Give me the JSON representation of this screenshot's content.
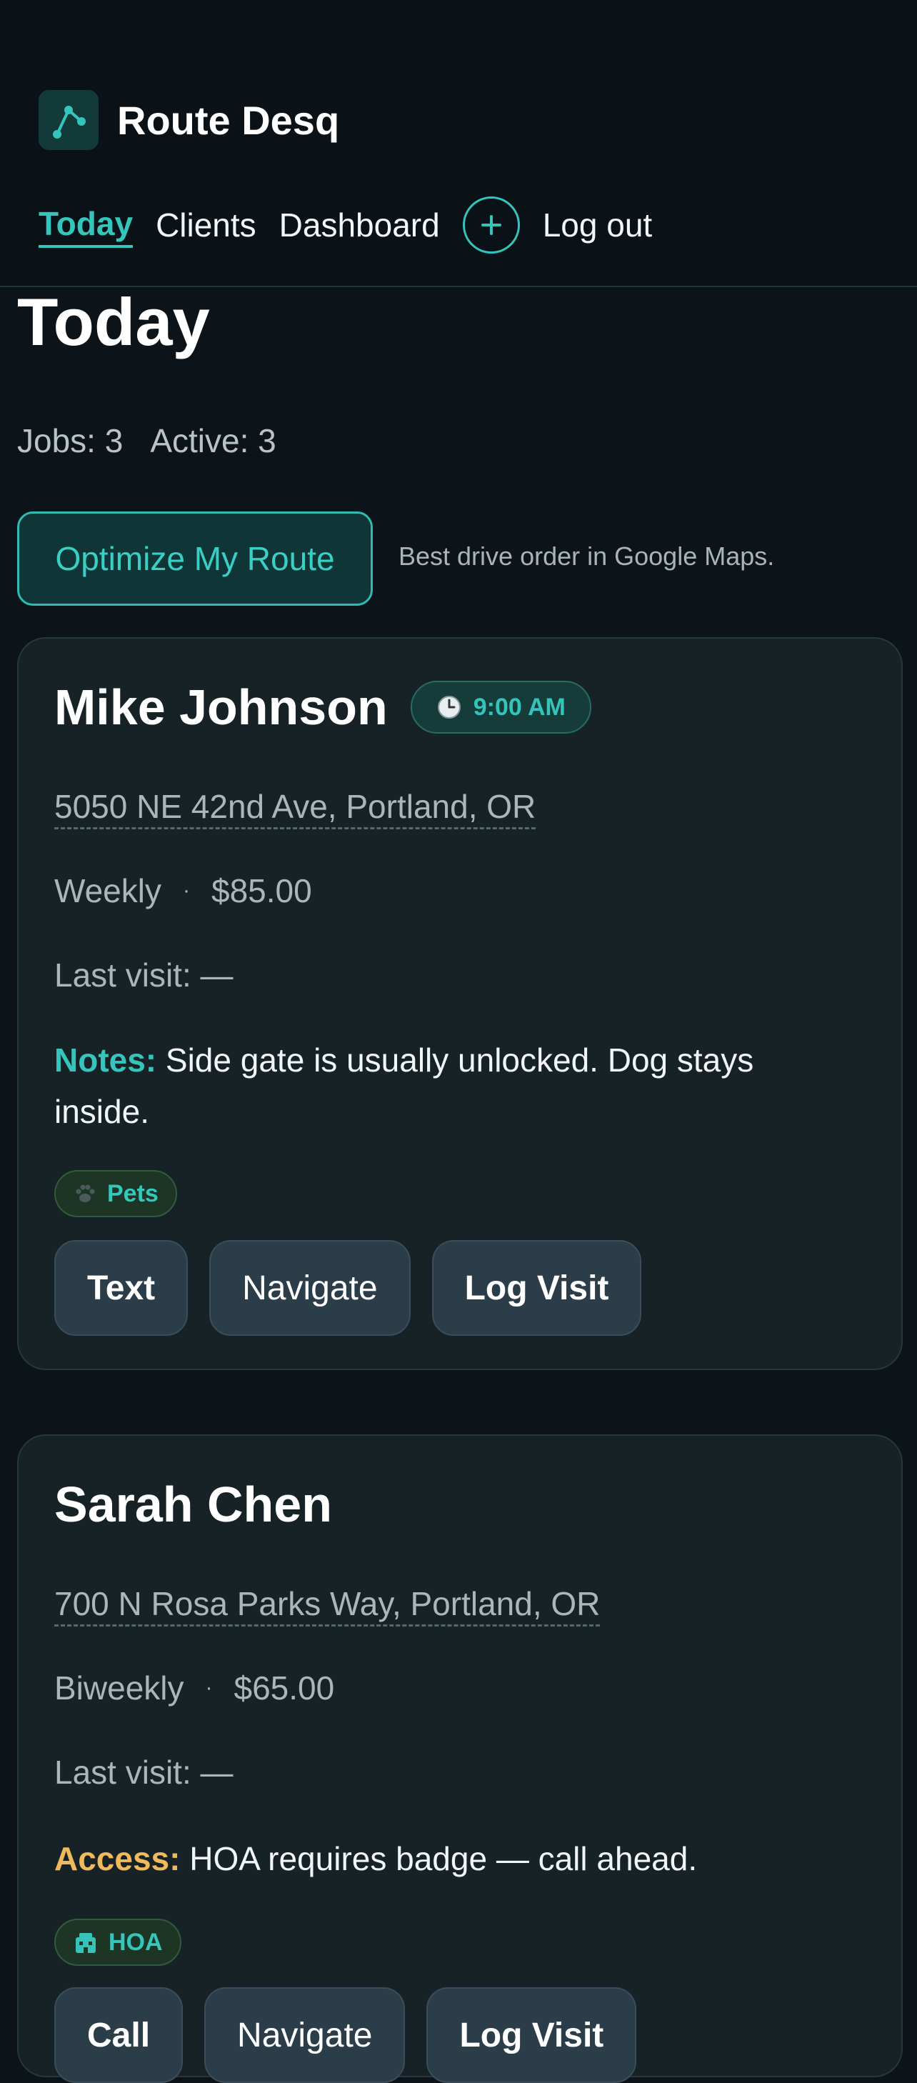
{
  "app": {
    "name": "Route Desq"
  },
  "nav": {
    "items": [
      {
        "label": "Today",
        "active": true
      },
      {
        "label": "Clients",
        "active": false
      },
      {
        "label": "Dashboard",
        "active": false
      }
    ],
    "add_icon": "plus-circle-icon",
    "logout_label": "Log out"
  },
  "page": {
    "title": "Today",
    "jobs": "Jobs: 3",
    "active": "Active: 3"
  },
  "optimize": {
    "button_label": "Optimize My Route",
    "hint": "Best drive order in Google Maps."
  },
  "jobs": [
    {
      "name": "Mike Johnson",
      "time": "9:00 AM",
      "address": "5050 NE 42nd Ave, Portland, OR",
      "frequency": "Weekly",
      "separator": "·",
      "price": "$85.00",
      "last_visit": "Last visit: —",
      "note_label": "Notes:",
      "note_text": "Side gate is usually unlocked. Dog stays inside.",
      "tag": "Pets",
      "tag_icon": "paw-icon",
      "actions": [
        "Text",
        "Navigate",
        "Log Visit"
      ]
    },
    {
      "name": "Sarah Chen",
      "address": "700 N Rosa Parks Way, Portland, OR",
      "frequency": "Biweekly",
      "separator": "·",
      "price": "$65.00",
      "last_visit": "Last visit: —",
      "note_label": "Access:",
      "note_text": "HOA requires badge — call ahead.",
      "tag": "HOA",
      "tag_icon": "building-icon",
      "actions": [
        "Call",
        "Navigate",
        "Log Visit"
      ]
    }
  ],
  "colors": {
    "accent": "#34c6bd",
    "background": "#0c1419",
    "card": "#172226",
    "access": "#f0b95c"
  }
}
